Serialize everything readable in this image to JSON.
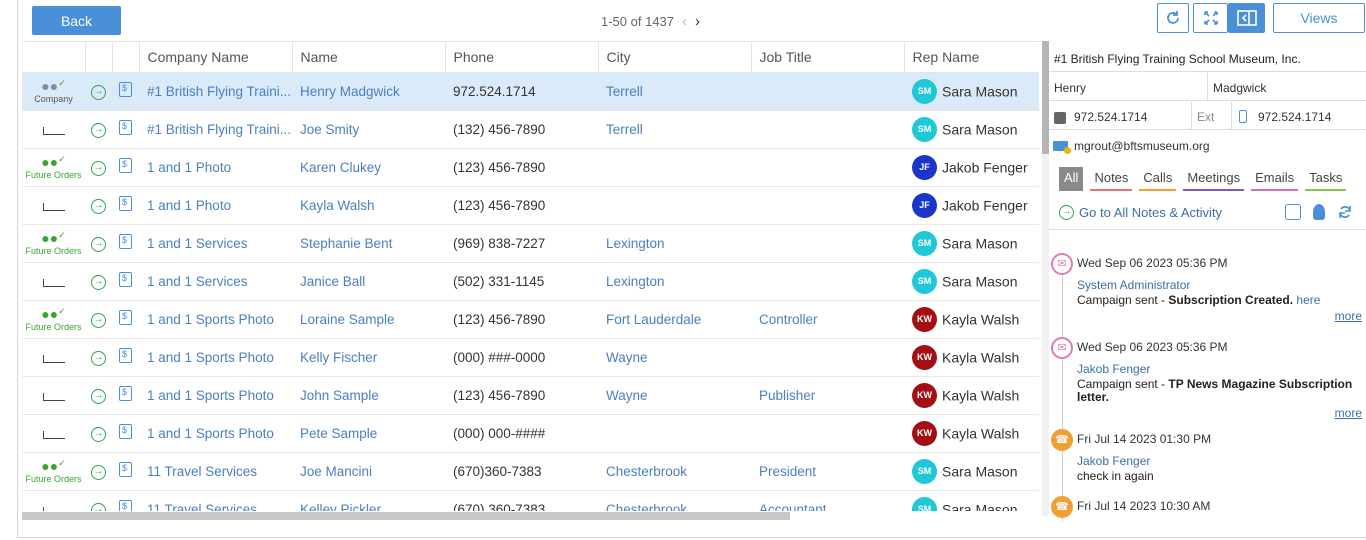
{
  "toolbar": {
    "back_label": "Back",
    "pager_text": "1-50 of 1437",
    "views_label": "Views"
  },
  "grid": {
    "columns": [
      "",
      "",
      "",
      "Company Name",
      "Name",
      "Phone",
      "City",
      "Job Title",
      "Rep Name"
    ],
    "rows": [
      {
        "type": "Company",
        "company": "#1 British Flying Traini...",
        "name": "Henry Madgwick",
        "phone": "972.524.1714",
        "city": "Terrell",
        "job": "",
        "rep": "Sara Mason",
        "initials": "SM"
      },
      {
        "type": "",
        "company": "#1 British Flying Traini...",
        "name": "Joe Smity",
        "phone": "(132) 456-7890",
        "city": "Terrell",
        "job": "",
        "rep": "Sara Mason",
        "initials": "SM"
      },
      {
        "type": "Future Orders",
        "company": "1 and 1 Photo",
        "name": "Karen Clukey",
        "phone": "(123) 456-7890",
        "city": "",
        "job": "",
        "rep": "Jakob Fenger",
        "initials": "JF"
      },
      {
        "type": "",
        "company": "1 and 1 Photo",
        "name": "Kayla Walsh",
        "phone": "(123) 456-7890",
        "city": "",
        "job": "",
        "rep": "Jakob Fenger",
        "initials": "JF"
      },
      {
        "type": "Future Orders",
        "company": "1 and 1 Services",
        "name": "Stephanie Bent",
        "phone": "(969) 838-7227",
        "city": "Lexington",
        "job": "",
        "rep": "Sara Mason",
        "initials": "SM"
      },
      {
        "type": "",
        "company": "1 and 1 Services",
        "name": "Janice Ball",
        "phone": "(502) 331-1145",
        "city": "Lexington",
        "job": "",
        "rep": "Sara Mason",
        "initials": "SM"
      },
      {
        "type": "Future Orders",
        "company": "1 and 1 Sports Photo",
        "name": "Loraine Sample",
        "phone": "(123) 456-7890",
        "city": "Fort Lauderdale",
        "job": "Controller",
        "rep": "Kayla Walsh",
        "initials": "KW"
      },
      {
        "type": "",
        "company": "1 and 1 Sports Photo",
        "name": "Kelly Fischer",
        "phone": "(000) ###-0000",
        "city": "Wayne",
        "job": "",
        "rep": "Kayla Walsh",
        "initials": "KW"
      },
      {
        "type": "",
        "company": "1 and 1 Sports Photo",
        "name": "John Sample",
        "phone": "(123) 456-7890",
        "city": "Wayne",
        "job": "Publisher",
        "rep": "Kayla Walsh",
        "initials": "KW"
      },
      {
        "type": "",
        "company": "1 and 1 Sports Photo",
        "name": "Pete Sample",
        "phone": "(000) 000-####",
        "city": "",
        "job": "",
        "rep": "Kayla Walsh",
        "initials": "KW"
      },
      {
        "type": "Future Orders",
        "company": "11 Travel Services",
        "name": "Joe Mancini",
        "phone": "(670)360-7383",
        "city": "Chesterbrook",
        "job": "President",
        "rep": "Sara Mason",
        "initials": "SM"
      },
      {
        "type": "",
        "company": "11 Travel Services",
        "name": "Kelley Pickler",
        "phone": "(670) 360-7383",
        "city": "Chesterbrook",
        "job": "Accountant",
        "rep": "Sara Mason",
        "initials": "SM"
      }
    ]
  },
  "avatar_colors": {
    "SM": "#1fc8d6",
    "JF": "#1a35c9",
    "KW": "#a30f12"
  },
  "detail": {
    "company": "#1 British Flying Training School Museum, Inc.",
    "first_name": "Henry",
    "last_name": "Madgwick",
    "phone": "972.524.1714",
    "ext_label": "Ext",
    "mobile": "972.524.1714",
    "email": "mgrout@bftsmuseum.org",
    "tabs": [
      "All",
      "Notes",
      "Calls",
      "Meetings",
      "Emails",
      "Tasks"
    ],
    "goto_label": "Go to All Notes & Activity",
    "events": [
      {
        "kind": "email",
        "date": "Wed Sep 06 2023 05:36 PM",
        "user": "System Administrator",
        "prefix": "Campaign sent - ",
        "bold": "Subscription Created.",
        "suffix": " here",
        "more": "more"
      },
      {
        "kind": "email",
        "date": "Wed Sep 06 2023 05:36 PM",
        "user": "Jakob Fenger",
        "prefix": "Campaign sent - ",
        "bold": "TP News Magazine Subscription letter.",
        "suffix": "",
        "more": "more"
      },
      {
        "kind": "call",
        "date": "Fri Jul 14 2023 01:30 PM",
        "user": "Jakob Fenger",
        "prefix": "check in again",
        "bold": "",
        "suffix": "",
        "more": ""
      },
      {
        "kind": "call",
        "date": "Fri Jul 14 2023 10:30 AM",
        "user": "",
        "prefix": "",
        "bold": "",
        "suffix": "",
        "more": ""
      }
    ]
  }
}
